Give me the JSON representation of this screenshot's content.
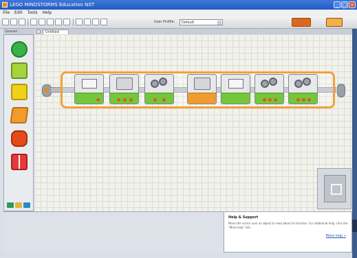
{
  "window": {
    "title": "LEGO MINDSTORMS Education NXT",
    "buttons": [
      "minimize",
      "maximize",
      "close"
    ]
  },
  "menu": {
    "items": [
      "File",
      "Edit",
      "Tools",
      "Help"
    ]
  },
  "toolbar": {
    "profile_label": "User Profile:",
    "profile_value": "Default"
  },
  "palette": {
    "tab_label": "Common",
    "items": [
      {
        "name": "green-circle",
        "color": "#39b24a"
      },
      {
        "name": "green-shirt",
        "color": "#a6d43b"
      },
      {
        "name": "yellow-hand",
        "color": "#f0d11a"
      },
      {
        "name": "orange-square",
        "color": "#f19a2e"
      },
      {
        "name": "red-octagon",
        "color": "#e44a1a"
      },
      {
        "name": "red-grid",
        "color": "#e53a3a"
      }
    ]
  },
  "canvas": {
    "tab_label": "Untitled",
    "blocks": [
      {
        "type": "display",
        "band": "green"
      },
      {
        "type": "sensor",
        "band": "green"
      },
      {
        "type": "motor",
        "band": "green"
      },
      {
        "type": "rotation",
        "band": "orange"
      },
      {
        "type": "display",
        "band": "green"
      },
      {
        "type": "motor",
        "band": "green"
      },
      {
        "type": "motor",
        "band": "green"
      }
    ]
  },
  "help": {
    "title": "Help & Support",
    "body": "Move the cursor over an object to read about its function. For additional help, click the \"More help\" link.",
    "more_link": "More help »"
  }
}
